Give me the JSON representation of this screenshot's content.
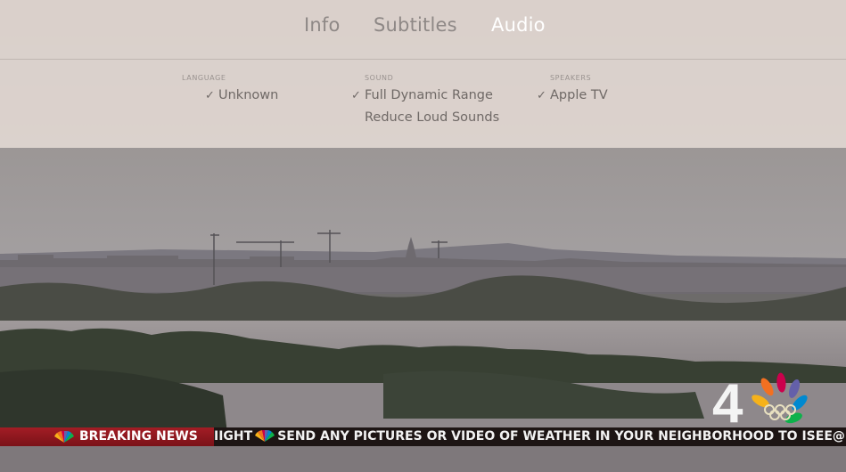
{
  "tabs": [
    {
      "label": "Info",
      "active": false
    },
    {
      "label": "Subtitles",
      "active": false
    },
    {
      "label": "Audio",
      "active": true
    }
  ],
  "columns": {
    "language": {
      "header": "LANGUAGE",
      "options": [
        {
          "label": "Unknown",
          "checked": true
        }
      ]
    },
    "sound": {
      "header": "SOUND",
      "options": [
        {
          "label": "Full Dynamic Range",
          "checked": true
        },
        {
          "label": "Reduce Loud Sounds",
          "checked": false
        }
      ]
    },
    "speakers": {
      "header": "SPEAKERS",
      "options": [
        {
          "label": "Apple TV",
          "checked": true
        }
      ]
    }
  },
  "checkmark": "✓",
  "broadcast": {
    "channel_number": "4",
    "breaking_label": "BREAKING NEWS",
    "ticker_prefix": "IIGHT",
    "ticker_text": "SEND ANY PICTURES OR VIDEO OF WEATHER IN YOUR NEIGHBORHOOD TO ISEE@N"
  },
  "colors": {
    "active_tab": "#ffffff",
    "breaking_red": "#a31d25",
    "panel": "#e0d6d1"
  }
}
